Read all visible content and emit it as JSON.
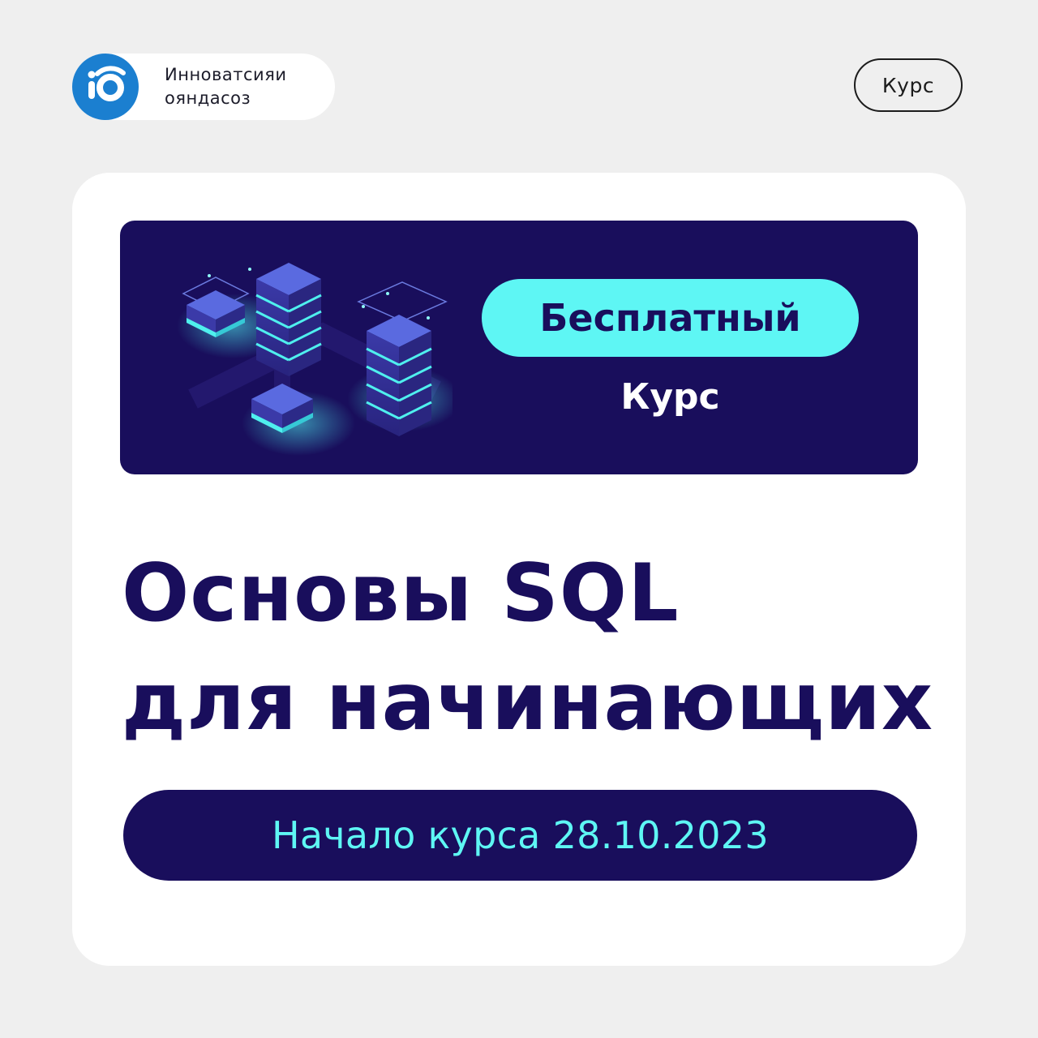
{
  "brand": {
    "logo_text": "io",
    "name_line1": "Инноватсияи",
    "name_line2": "ояндасоз"
  },
  "header": {
    "tag_label": "Курс"
  },
  "banner": {
    "free_label": "Бесплатный",
    "subtitle": "Курс"
  },
  "main": {
    "title_line1": "Основы SQL",
    "title_line2": "для начинающих",
    "start_label": "Начало курса 28.10.2023"
  },
  "colors": {
    "page_bg": "#efefef",
    "navy": "#190e5c",
    "cyan": "#5ef6f4",
    "logo_blue": "#1b7fd0"
  }
}
